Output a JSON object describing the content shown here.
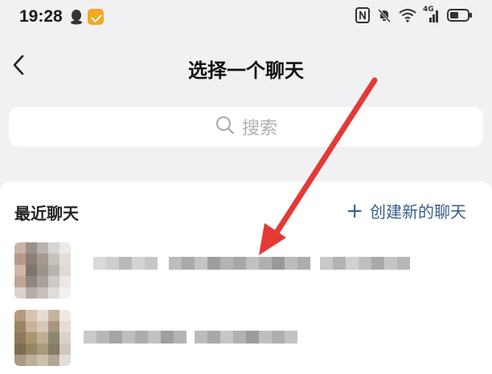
{
  "status": {
    "time": "19:28",
    "network": "4G"
  },
  "header": {
    "title": "选择一个聊天",
    "back_icon": "chevron-left-icon"
  },
  "search": {
    "placeholder": "搜索"
  },
  "recent": {
    "section_title": "最近聊天",
    "new_chat_plus": "+",
    "new_chat_label": "创建新的聊天"
  },
  "colors": {
    "background": "#f1f1f3",
    "panel": "#ffffff",
    "link": "#3a5f8a",
    "annotation_arrow": "#e53935",
    "placeholder": "#b0b0b4"
  }
}
